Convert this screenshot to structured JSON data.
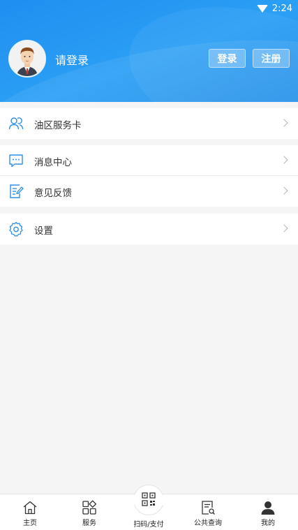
{
  "status_bar": {
    "time": "2:24"
  },
  "header": {
    "login_prompt": "请登录",
    "login_button": "登录",
    "register_button": "注册"
  },
  "menu": {
    "group1": [
      {
        "label": "油区服务卡",
        "icon": "people-icon"
      }
    ],
    "group2": [
      {
        "label": "消息中心",
        "icon": "message-icon"
      },
      {
        "label": "意见反馈",
        "icon": "feedback-icon"
      }
    ],
    "group3": [
      {
        "label": "设置",
        "icon": "gear-icon"
      }
    ]
  },
  "tabbar": {
    "items": [
      {
        "label": "主页",
        "icon": "home-icon"
      },
      {
        "label": "服务",
        "icon": "grid-icon"
      },
      {
        "label": "扫码/支付",
        "icon": "qr-code-icon"
      },
      {
        "label": "公共查询",
        "icon": "document-search-icon"
      },
      {
        "label": "我的",
        "icon": "person-icon"
      }
    ]
  }
}
